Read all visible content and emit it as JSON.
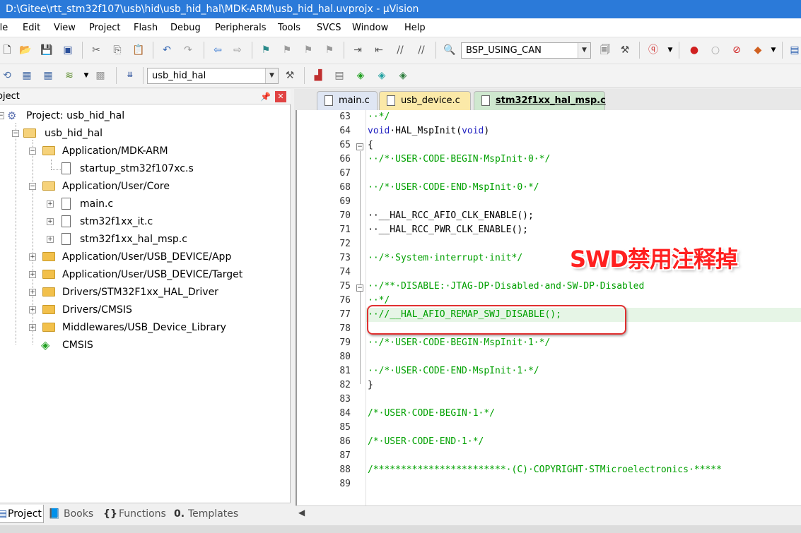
{
  "window": {
    "title": "D:\\Gitee\\rtt_stm32f107\\usb\\hid\\usb_hid_hal\\MDK-ARM\\usb_hid_hal.uvprojx - µVision"
  },
  "menu": {
    "items": [
      "ile",
      "Edit",
      "View",
      "Project",
      "Flash",
      "Debug",
      "Peripherals",
      "Tools",
      "SVCS",
      "Window",
      "Help"
    ]
  },
  "toolbar1": {
    "target_combo": "BSP_USING_CAN"
  },
  "toolbar2": {
    "target_select": "usb_hid_hal"
  },
  "project_panel": {
    "title": "oject",
    "tree": [
      {
        "label": "Project: usb_hid_hal"
      },
      {
        "label": "usb_hid_hal"
      },
      {
        "label": "Application/MDK-ARM"
      },
      {
        "label": "startup_stm32f107xc.s"
      },
      {
        "label": "Application/User/Core"
      },
      {
        "label": "main.c"
      },
      {
        "label": "stm32f1xx_it.c"
      },
      {
        "label": "stm32f1xx_hal_msp.c"
      },
      {
        "label": "Application/User/USB_DEVICE/App"
      },
      {
        "label": "Application/User/USB_DEVICE/Target"
      },
      {
        "label": "Drivers/STM32F1xx_HAL_Driver"
      },
      {
        "label": "Drivers/CMSIS"
      },
      {
        "label": "Middlewares/USB_Device_Library"
      },
      {
        "label": "CMSIS"
      }
    ],
    "bottom_tabs": [
      "Project",
      "Books",
      "Functions",
      "Templates"
    ]
  },
  "editor": {
    "tabs": [
      "main.c",
      "usb_device.c",
      "stm32f1xx_hal_msp.c"
    ],
    "active_tab": "stm32f1xx_hal_msp.c",
    "lines": [
      {
        "num": "63",
        "text": "··*/",
        "style": "comment"
      },
      {
        "num": "64",
        "text": "void·HAL_MspInit(void)",
        "style": "code"
      },
      {
        "num": "65",
        "text": "{",
        "style": "code"
      },
      {
        "num": "66",
        "text": "··/*·USER·CODE·BEGIN·MspInit·0·*/",
        "style": "comment"
      },
      {
        "num": "67",
        "text": "",
        "style": "code"
      },
      {
        "num": "68",
        "text": "··/*·USER·CODE·END·MspInit·0·*/",
        "style": "comment"
      },
      {
        "num": "69",
        "text": "",
        "style": "code"
      },
      {
        "num": "70",
        "text": "··__HAL_RCC_AFIO_CLK_ENABLE();",
        "style": "code"
      },
      {
        "num": "71",
        "text": "··__HAL_RCC_PWR_CLK_ENABLE();",
        "style": "code"
      },
      {
        "num": "72",
        "text": "",
        "style": "code"
      },
      {
        "num": "73",
        "text": "··/*·System·interrupt·init*/",
        "style": "comment"
      },
      {
        "num": "74",
        "text": "",
        "style": "code"
      },
      {
        "num": "75",
        "text": "··/**·DISABLE:·JTAG-DP·Disabled·and·SW-DP·Disabled",
        "style": "comment"
      },
      {
        "num": "76",
        "text": "··*/",
        "style": "comment"
      },
      {
        "num": "77",
        "text": "··//__HAL_AFIO_REMAP_SWJ_DISABLE();",
        "style": "comment"
      },
      {
        "num": "78",
        "text": "",
        "style": "code"
      },
      {
        "num": "79",
        "text": "··/*·USER·CODE·BEGIN·MspInit·1·*/",
        "style": "comment"
      },
      {
        "num": "80",
        "text": "",
        "style": "code"
      },
      {
        "num": "81",
        "text": "··/*·USER·CODE·END·MspInit·1·*/",
        "style": "comment"
      },
      {
        "num": "82",
        "text": "}",
        "style": "code"
      },
      {
        "num": "83",
        "text": "",
        "style": "code"
      },
      {
        "num": "84",
        "text": "/*·USER·CODE·BEGIN·1·*/",
        "style": "comment"
      },
      {
        "num": "85",
        "text": "",
        "style": "code"
      },
      {
        "num": "86",
        "text": "/*·USER·CODE·END·1·*/",
        "style": "comment"
      },
      {
        "num": "87",
        "text": "",
        "style": "code"
      },
      {
        "num": "88",
        "text": "/************************·(C)·COPYRIGHT·STMicroelectronics·*****",
        "style": "comment"
      },
      {
        "num": "89",
        "text": "",
        "style": "code"
      }
    ],
    "annotation": "SWD禁用注释掉"
  },
  "colors": {
    "titlebar": "#2b7ad9",
    "comment": "#00a000",
    "keyword": "#2020c0",
    "annotation": "#ff2020"
  }
}
